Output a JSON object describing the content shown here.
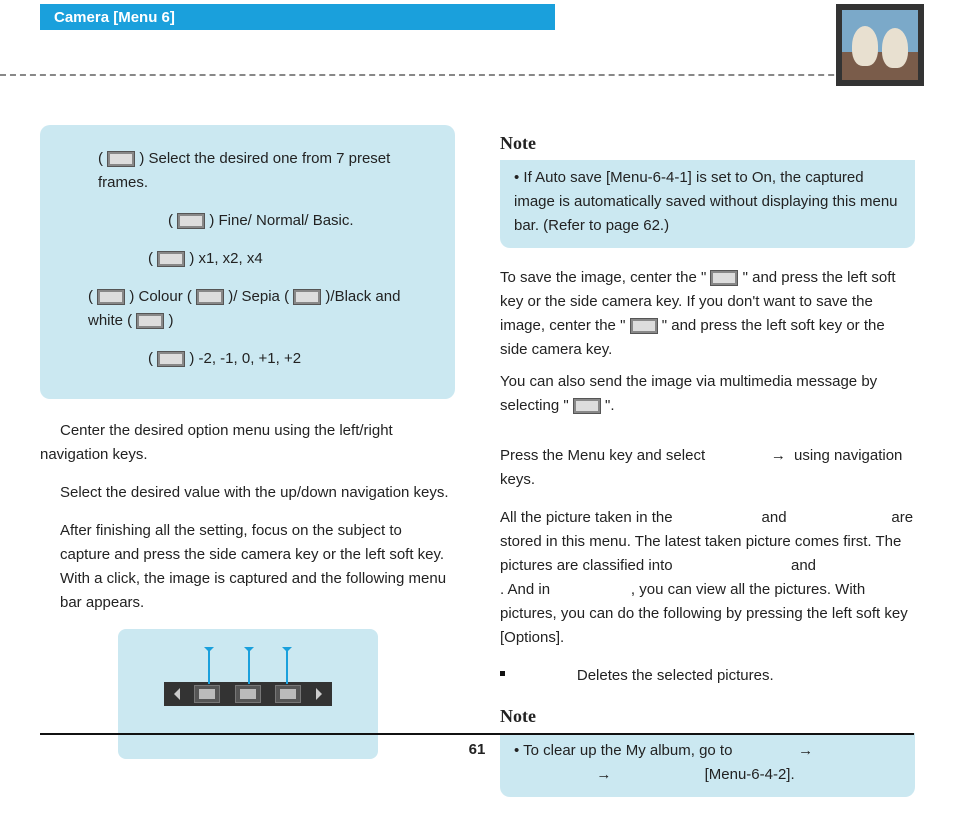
{
  "header": {
    "title": "Camera [Menu 6]"
  },
  "left": {
    "box": {
      "l1a": "(",
      "l1b": ")  Select the desired one from 7 preset frames.",
      "l2a": "(",
      "l2b": ")  Fine/ Normal/ Basic.",
      "l3a": "(",
      "l3b": ")  x1, x2, x4",
      "l4a": "(",
      "l4b": ")  Colour (",
      "l4c": ")/ Sepia (",
      "l4d": " )/Black and white (",
      "l4e": ")",
      "l5a": "(",
      "l5b": ")  -2, -1, 0, +1, +2"
    },
    "p1": "Center the desired option menu using the left/right navigation keys.",
    "p2": "Select the desired value with the up/down navigation keys.",
    "p3": "After finishing all the setting, focus on the subject to capture and press the side camera key or the left soft key. With a click, the image is captured and the following menu bar appears."
  },
  "right": {
    "note1_heading": "Note",
    "note1_body": "If Auto save [Menu-6-4-1] is set to On, the captured image is automatically saved without displaying this menu bar. (Refer to page 62.)",
    "p1a": "To save the image, center the \"",
    "p1b": "\" and press the left soft key or the side camera key. If you don't want to save the image, center the \"",
    "p1c": "\" and press the left soft key or the side camera key.",
    "p2a": "You can also send the image via multimedia message by selecting \"",
    "p2b": "\".",
    "p3a": "Press the Menu key and select ",
    "p3b": " using navigation keys.",
    "p4a": "All the picture taken in the ",
    "p4b": " and ",
    "p4c": " are stored in this menu. The latest taken picture comes first. The pictures are classified into ",
    "p4d": " and ",
    "p4e": ". And in ",
    "p4f": ", you can view all the pictures. With pictures, you can do the following by pressing the left soft key [Options].",
    "bullet1": "Deletes the selected pictures.",
    "note2_heading": "Note",
    "note2a": "To clear up the My album, go to ",
    "note2b": " [Menu-6-4-2].",
    "arrow": "→"
  },
  "page_number": "61"
}
